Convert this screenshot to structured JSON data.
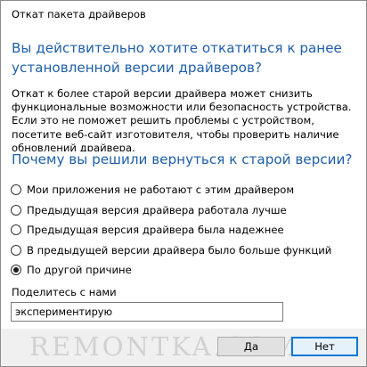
{
  "window": {
    "title": "Откат пакета драйверов"
  },
  "dialog": {
    "question": "Вы действительно хотите откатиться к ранее установленной версии драйверов?",
    "description": "Откат к более старой версии драйвера может снизить функциональные возможности или безопасность устройства. Если это не поможет решить проблемы с устройством, посетите веб-сайт изготовителя, чтобы проверить наличие обновлений драйвера.",
    "reason_heading": "Почему вы решили вернуться к старой версии?",
    "options": [
      {
        "label": "Мои приложения не работают с этим драйвером",
        "checked": false
      },
      {
        "label": "Предыдущая версия драйвера работала лучше",
        "checked": false
      },
      {
        "label": "Предыдущая версия драйвера была надежнее",
        "checked": false
      },
      {
        "label": "В предыдущей версии драйвера было больше функций",
        "checked": false
      },
      {
        "label": "По другой причине",
        "checked": true
      }
    ],
    "share_label": "Поделитесь с нами",
    "share_value": "экспериментирую"
  },
  "footer": {
    "watermark": "REMONTKA.COM",
    "yes_label": "Да",
    "no_label": "Нет"
  },
  "colors": {
    "accent": "#1f5fa8",
    "focus_border": "#0078d7",
    "footer_bg": "#f0f0f0"
  }
}
